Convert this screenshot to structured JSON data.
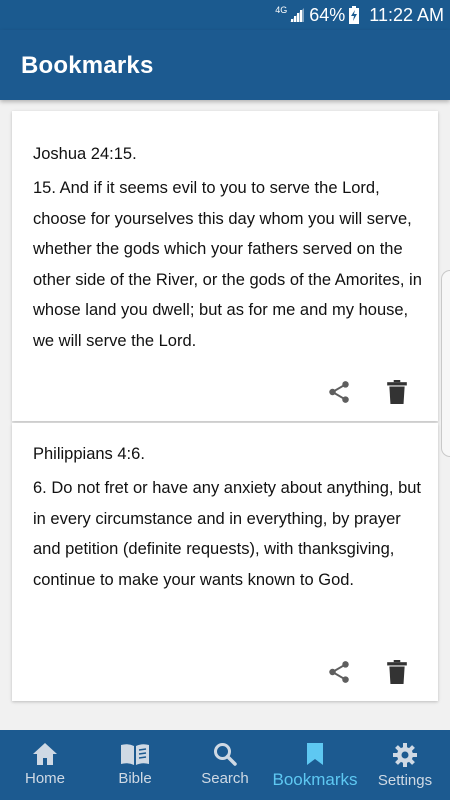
{
  "status": {
    "network": "4G",
    "battery": "64%",
    "time": "11:22 AM"
  },
  "header": {
    "title": "Bookmarks"
  },
  "bookmarks": [
    {
      "reference": "Joshua 24:15.",
      "text": "15. And if it seems evil to you to serve the Lord, choose for yourselves this day whom you will serve, whether the gods which your fathers served on the other side of the River, or the gods of the Amorites, in whose land you dwell; but as for me and my house, we will serve the Lord."
    },
    {
      "reference": "Philippians 4:6.",
      "text": "6. Do not fret or have any anxiety about anything, but in every circumstance and in everything, by prayer and petition (definite requests), with thanksgiving, continue to make your wants known to God."
    }
  ],
  "nav": {
    "items": [
      {
        "label": "Home",
        "icon": "home-icon"
      },
      {
        "label": "Bible",
        "icon": "book-icon"
      },
      {
        "label": "Search",
        "icon": "search-icon"
      },
      {
        "label": "Bookmarks",
        "icon": "bookmark-icon"
      },
      {
        "label": "Settings",
        "icon": "gear-icon"
      }
    ],
    "active": "Bookmarks"
  },
  "colors": {
    "primary": "#1c5a90",
    "active_tab": "#5ec8f2",
    "inactive_tab": "#cfd9e4"
  }
}
